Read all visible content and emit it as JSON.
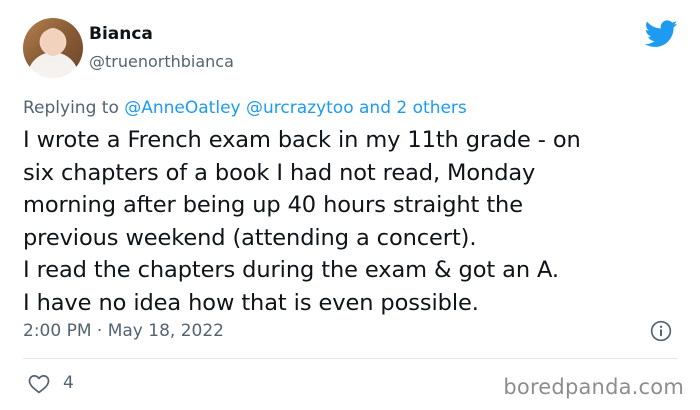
{
  "author": {
    "display_name": "Bianca",
    "handle": "@truenorthbianca"
  },
  "reply": {
    "prefix": "Replying to",
    "mention_1": "@AnneOatley",
    "mention_2": "@urcrazytoo",
    "suffix": "and 2 others"
  },
  "tweet": {
    "lines": [
      "I wrote a French exam back in my 11th grade - on",
      "six chapters of a book I had not read, Monday",
      "morning after being up 40 hours straight the",
      "previous weekend (attending a concert).",
      "I read the chapters during the exam & got an A.",
      "I have no idea how that is even possible."
    ],
    "timestamp": "2:00 PM · May 18, 2022",
    "likes": "4"
  },
  "icons": {
    "logo": "twitter-bird-icon",
    "info": "info-icon",
    "like": "heart-icon"
  },
  "colors": {
    "accent": "#1d9bf0",
    "secondary_text": "#536471",
    "primary_text": "#0f1419"
  },
  "watermark": "boredpanda.com"
}
